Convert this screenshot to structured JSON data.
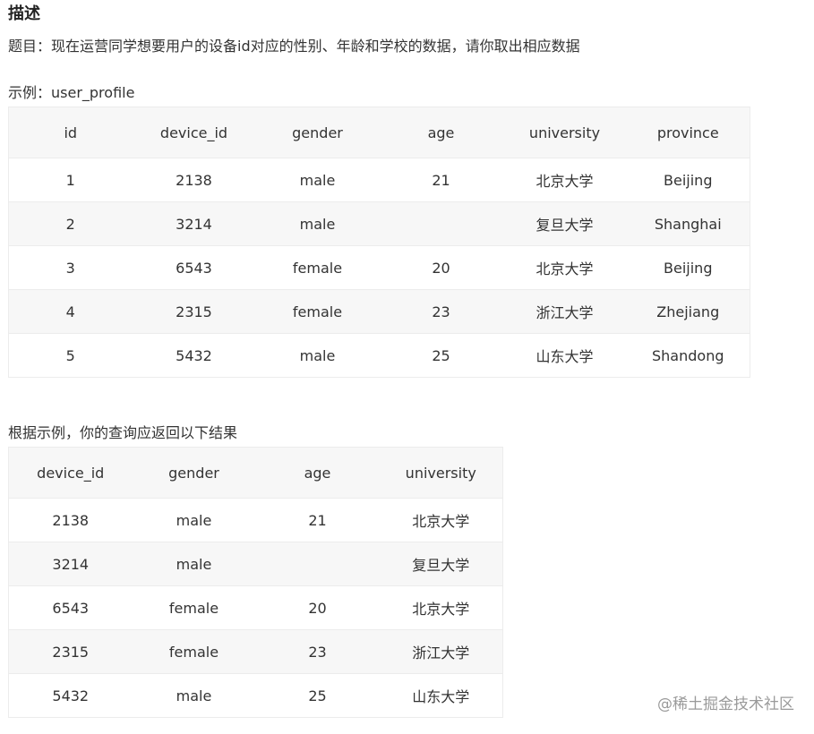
{
  "heading": "描述",
  "description": "题目：现在运营同学想要用户的设备id对应的性别、年龄和学校的数据，请你取出相应数据",
  "example_label": "示例：user_profile",
  "example_table": {
    "headers": [
      "id",
      "device_id",
      "gender",
      "age",
      "university",
      "province"
    ],
    "rows": [
      [
        "1",
        "2138",
        "male",
        "21",
        "北京大学",
        "Beijing"
      ],
      [
        "2",
        "3214",
        "male",
        "",
        "复旦大学",
        "Shanghai"
      ],
      [
        "3",
        "6543",
        "female",
        "20",
        "北京大学",
        "Beijing"
      ],
      [
        "4",
        "2315",
        "female",
        "23",
        "浙江大学",
        "Zhejiang"
      ],
      [
        "5",
        "5432",
        "male",
        "25",
        "山东大学",
        "Shandong"
      ]
    ]
  },
  "result_label": "根据示例，你的查询应返回以下结果",
  "result_table": {
    "headers": [
      "device_id",
      "gender",
      "age",
      "university"
    ],
    "rows": [
      [
        "2138",
        "male",
        "21",
        "北京大学"
      ],
      [
        "3214",
        "male",
        "",
        "复旦大学"
      ],
      [
        "6543",
        "female",
        "20",
        "北京大学"
      ],
      [
        "2315",
        "female",
        "23",
        "浙江大学"
      ],
      [
        "5432",
        "male",
        "25",
        "山东大学"
      ]
    ]
  },
  "watermark": "@稀土掘金技术社区"
}
